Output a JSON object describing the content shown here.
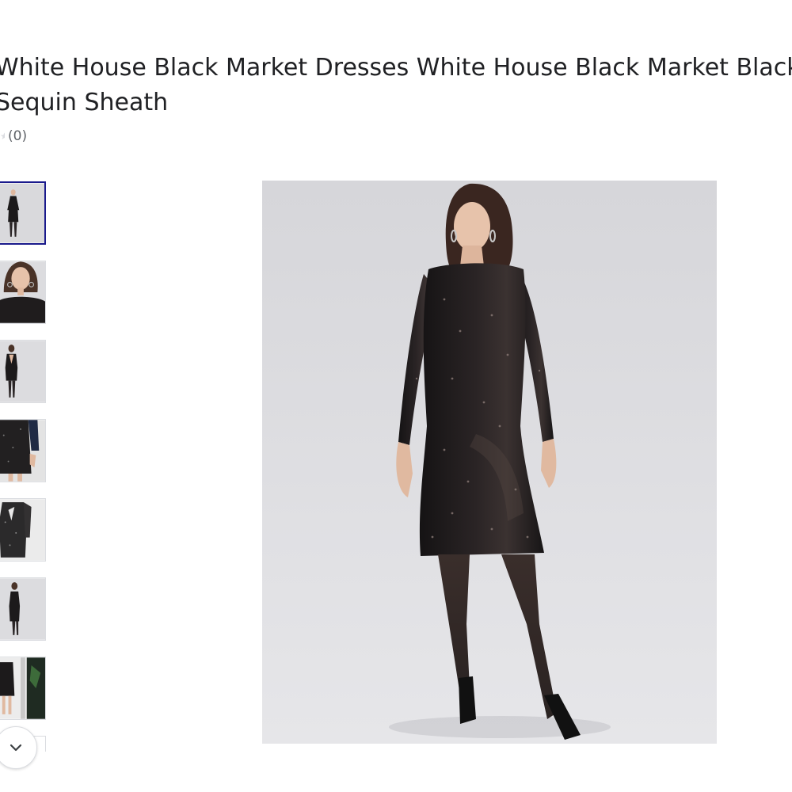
{
  "product": {
    "title": "White House Black Market Dresses White House Black Market Black Sequin Sheath",
    "rating_count": "(0)"
  },
  "gallery": {
    "thumbnails": [
      {
        "icon": "dress-front-full-image",
        "selected": true
      },
      {
        "icon": "dress-closeup-image",
        "selected": false
      },
      {
        "icon": "dress-back-image",
        "selected": false
      },
      {
        "icon": "dress-hem-detail-image",
        "selected": false
      },
      {
        "icon": "dress-hanging-image",
        "selected": false
      },
      {
        "icon": "dress-side-image",
        "selected": false
      },
      {
        "icon": "dress-mirror-image",
        "selected": false
      }
    ],
    "scroll_icon": "chevron-down-icon",
    "main_image": "black-sequin-sheath-dress-image"
  },
  "colors": {
    "selected_border": "#1a1a8c",
    "photo_background": "#dcdcdf"
  }
}
